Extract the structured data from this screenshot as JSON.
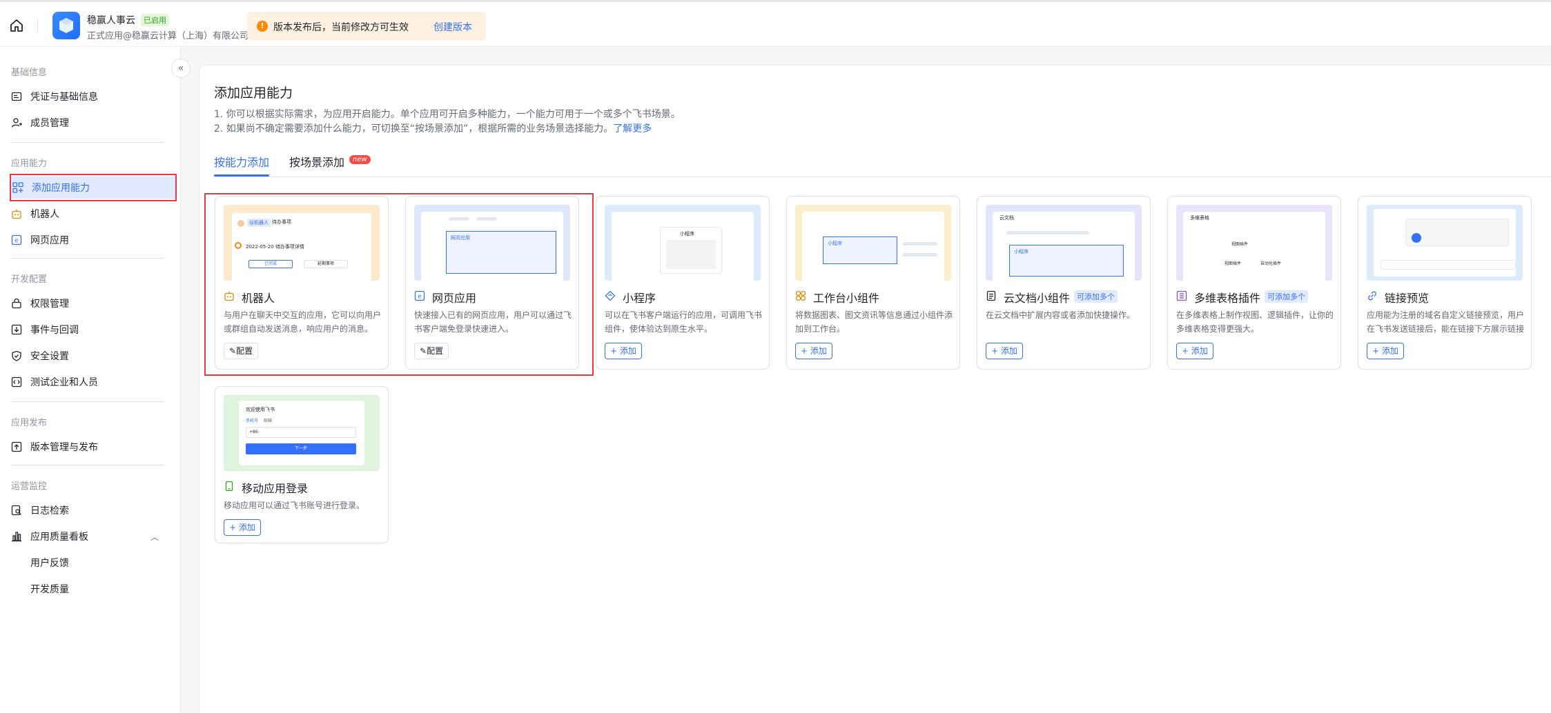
{
  "topbar": {
    "app_name": "稳赢人事云",
    "app_badge": "已启用",
    "app_sub": "正式应用@稳赢云计算（上海）有限公司",
    "notice_text": "版本发布后，当前修改方可生效",
    "notice_link": "创建版本"
  },
  "sidebar": {
    "sections": {
      "basic": "基础信息",
      "ability": "应用能力",
      "dev": "开发配置",
      "release": "应用发布",
      "ops": "运营监控"
    },
    "items": {
      "credentials": "凭证与基础信息",
      "members": "成员管理",
      "add_ability": "添加应用能力",
      "bot": "机器人",
      "web_app": "网页应用",
      "permissions": "权限管理",
      "events": "事件与回调",
      "security": "安全设置",
      "test_org": "测试企业和人员",
      "version": "版本管理与发布",
      "log": "日志检索",
      "quality": "应用质量看板",
      "feedback": "用户反馈",
      "dev_quality": "开发质量"
    }
  },
  "main": {
    "title": "添加应用能力",
    "desc1": "1. 你可以根据实际需求，为应用开启能力。单个应用可开启多种能力，一个能力可用于一个或多个飞书场景。",
    "desc2": "2. 如果尚不确定需要添加什么能力，可切换至“按场景添加”，根据所需的业务场景选择能力。",
    "learn_more": "了解更多",
    "tabs": {
      "by_ability": "按能力添加",
      "by_scene": "按场景添加",
      "new_badge": "new"
    },
    "cards": {
      "bot": {
        "title": "机器人",
        "desc": "与用户在聊天中交互的应用，它可以向用户或群组自动发送消息，响应用户的消息。",
        "btn": "配置",
        "thumb_tag1": "@机器人",
        "thumb_tag2": "待办事项",
        "thumb_text": "2022-05-20 待办事项详情",
        "thumb_btn1": "已完成",
        "thumb_btn2": "延期事项"
      },
      "web": {
        "title": "网页应用",
        "desc": "快速接入已有的网页应用，用户可以通过飞书客户端免登录快速进入。",
        "btn": "配置",
        "thumb_label": "网页应用"
      },
      "mini": {
        "title": "小程序",
        "desc": "可以在飞书客户端运行的应用，可调用飞书组件，使体验达到原生水平。",
        "btn": "+ 添加",
        "thumb_label": "小程序"
      },
      "widget": {
        "title": "工作台小组件",
        "desc": "将数据图表、图文资讯等信息通过小组件添加到工作台。",
        "btn": "+ 添加",
        "thumb_label": "小程序"
      },
      "doc": {
        "title": "云文档小组件",
        "badge": "可添加多个",
        "desc": "在云文档中扩展内容或者添加快捷操作。",
        "btn": "+ 添加",
        "thumb_title": "云文档",
        "thumb_label": "小程序"
      },
      "bitable": {
        "title": "多维表格插件",
        "badge": "可添加多个",
        "desc": "在多维表格上制作视图、逻辑插件，让你的多维表格变得更强大。",
        "btn": "+ 添加",
        "thumb_title": "多维表格",
        "thumb_lbl1": "视图插件",
        "thumb_lbl2": "自动化插件"
      },
      "link": {
        "title": "链接预览",
        "desc": "应用能为注册的域名自定义链接预览，用户在飞书发送链接后，能在链接下方展示链接预览信息。",
        "btn": "+ 添加"
      },
      "mobile": {
        "title": "移动应用登录",
        "desc": "移动应用可以通过飞书账号进行登录。",
        "btn": "+ 添加",
        "thumb_title": "欢迎使用飞书",
        "thumb_tab1": "手机号",
        "thumb_tab2": "邮箱",
        "thumb_code": "+86",
        "thumb_btn": "下一步"
      }
    }
  },
  "colors": {
    "accent": "#3370ff",
    "highlight_box": "#e33b3b",
    "warning": "#ff8800"
  }
}
